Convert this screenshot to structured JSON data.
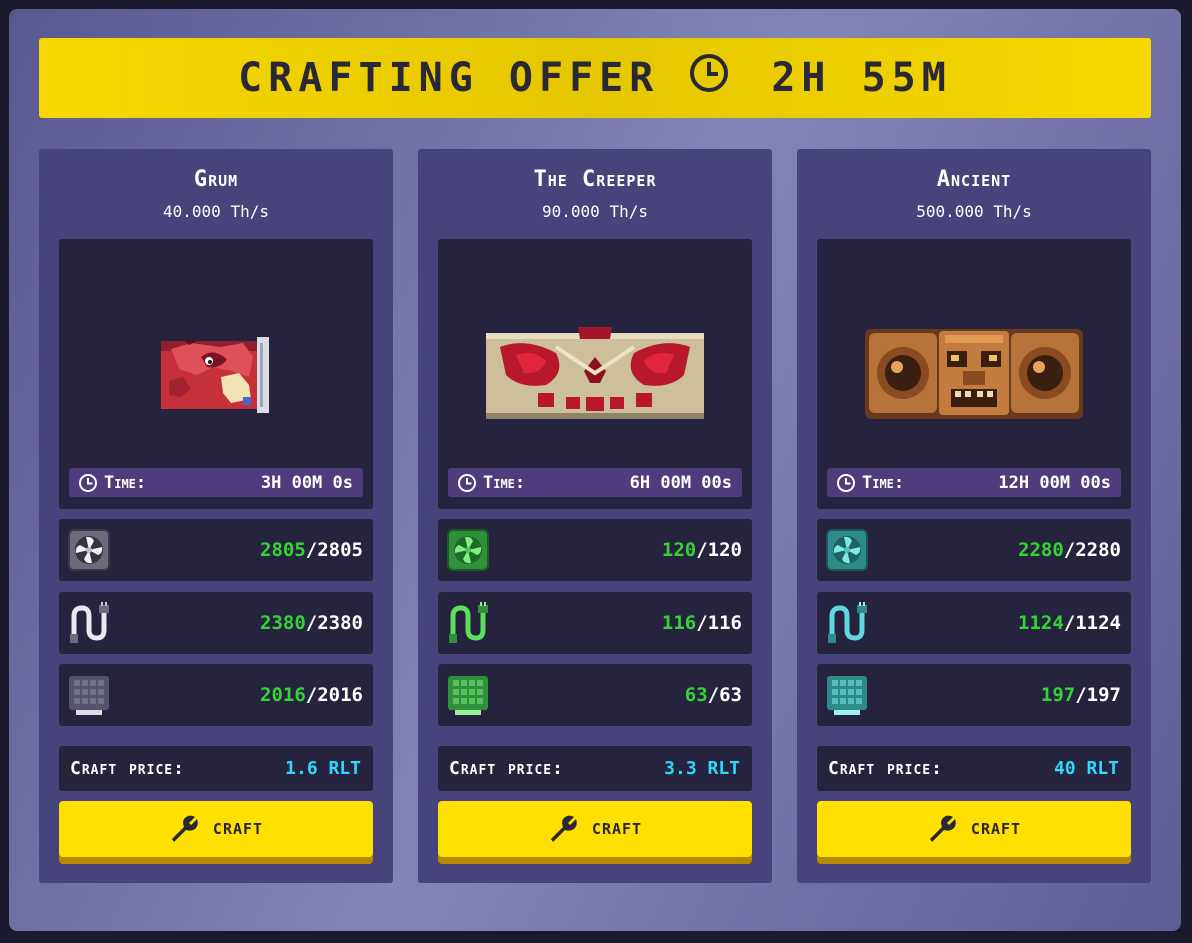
{
  "banner": {
    "title": "CRAFTING OFFER",
    "timer": "2H 55M"
  },
  "labels": {
    "time": "Time:",
    "craft_price": "Craft price:",
    "craft_button": "CRAFT"
  },
  "colors": {
    "accent": "#ffe000",
    "have": "#33d433",
    "price": "#2ed9ff",
    "card": "#46447a",
    "panel": "#25233d",
    "timebar": "#4f3c7c"
  },
  "cards": [
    {
      "name": "Grum",
      "power": "40.000 Th/s",
      "time": "3H 00M 0s",
      "price": "1.6 RLT",
      "parts": [
        {
          "icon": "fan-icon",
          "have": "2805",
          "need": "/2805"
        },
        {
          "icon": "wire-icon",
          "have": "2380",
          "need": "/2380"
        },
        {
          "icon": "hashboard-icon",
          "have": "2016",
          "need": "/2016"
        }
      ]
    },
    {
      "name": "The Creeper",
      "power": "90.000 Th/s",
      "time": "6H 00M 00s",
      "price": "3.3 RLT",
      "parts": [
        {
          "icon": "fan-icon",
          "have": "120",
          "need": "/120"
        },
        {
          "icon": "wire-icon",
          "have": "116",
          "need": "/116"
        },
        {
          "icon": "hashboard-icon",
          "have": "63",
          "need": "/63"
        }
      ]
    },
    {
      "name": "Ancient",
      "power": "500.000 Th/s",
      "time": "12H 00M 00s",
      "price": "40 RLT",
      "parts": [
        {
          "icon": "fan-icon",
          "have": "2280",
          "need": "/2280"
        },
        {
          "icon": "wire-icon",
          "have": "1124",
          "need": "/1124"
        },
        {
          "icon": "hashboard-icon",
          "have": "197",
          "need": "/197"
        }
      ]
    }
  ]
}
